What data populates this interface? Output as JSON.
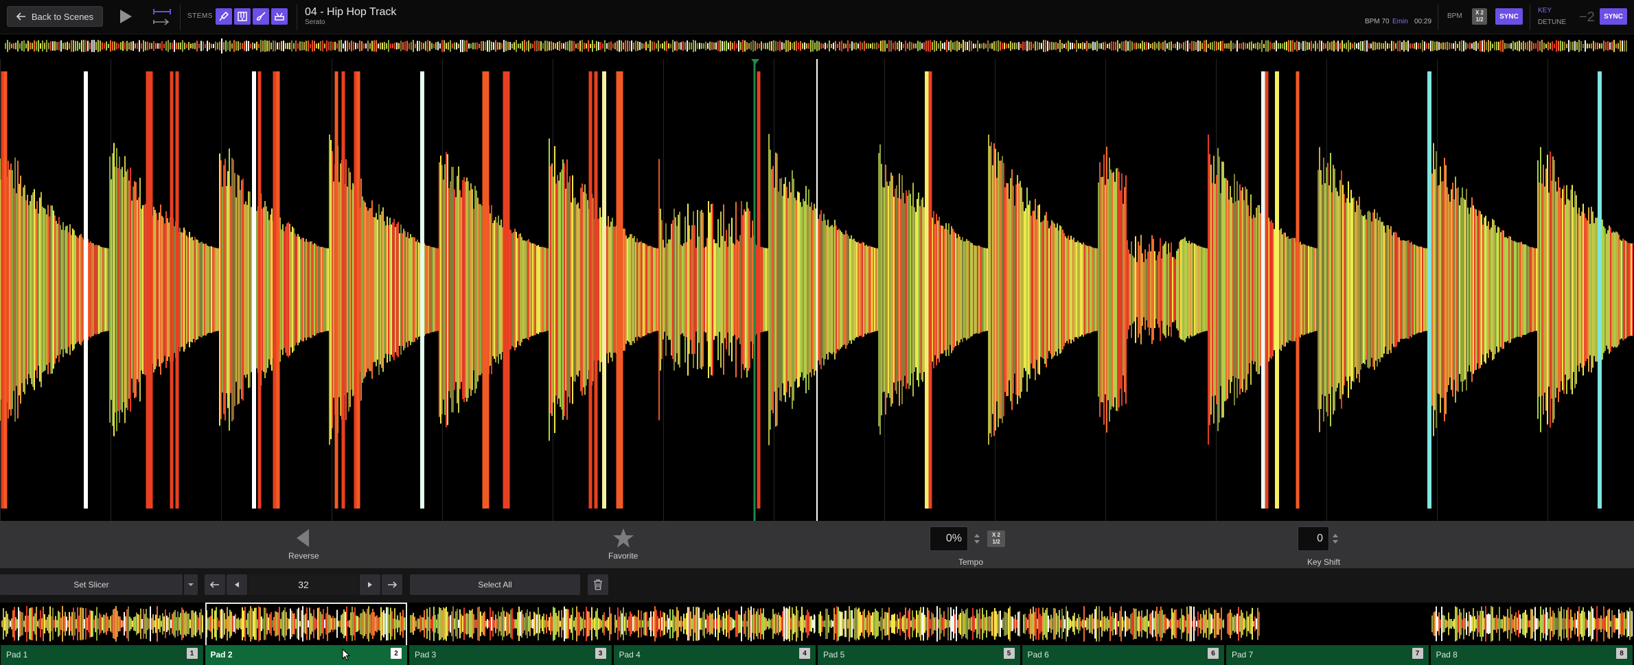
{
  "topbar": {
    "back_label": "Back to Scenes",
    "stems_label": "STEMS",
    "stem_icons": [
      "mic-icon",
      "keys-icon",
      "guitar-icon",
      "drums-icon"
    ],
    "track_title": "04 - Hip Hop Track",
    "track_artist": "Serato",
    "bpm_info": "BPM 70",
    "key_info": "Emin",
    "time_info": "00:29",
    "bpm_label": "BPM",
    "multiply_label": "X 2",
    "divide_label": "1/2",
    "sync_label": "SYNC",
    "key_label": "KEY",
    "detune_label": "DETUNE",
    "detune_value": "−2",
    "accent_color": "#6b4fe6"
  },
  "controls": {
    "reverse_label": "Reverse",
    "favorite_label": "Favorite",
    "tempo_value": "0%",
    "tempo_label": "Tempo",
    "tempo_multiply": "X 2",
    "tempo_divide": "1/2",
    "keyshift_value": "0",
    "keyshift_label": "Key Shift"
  },
  "slicer": {
    "set_slicer_label": "Set Slicer",
    "slice_count": "32",
    "select_all_label": "Select All"
  },
  "pads": [
    {
      "name": "Pad 1",
      "num": "1",
      "selected": false
    },
    {
      "name": "Pad 2",
      "num": "2",
      "selected": true
    },
    {
      "name": "Pad 3",
      "num": "3",
      "selected": false
    },
    {
      "name": "Pad 4",
      "num": "4",
      "selected": false
    },
    {
      "name": "Pad 5",
      "num": "5",
      "selected": false
    },
    {
      "name": "Pad 6",
      "num": "6",
      "selected": false
    },
    {
      "name": "Pad 7",
      "num": "7",
      "selected": false
    },
    {
      "name": "Pad 8",
      "num": "8",
      "selected": false
    }
  ]
}
